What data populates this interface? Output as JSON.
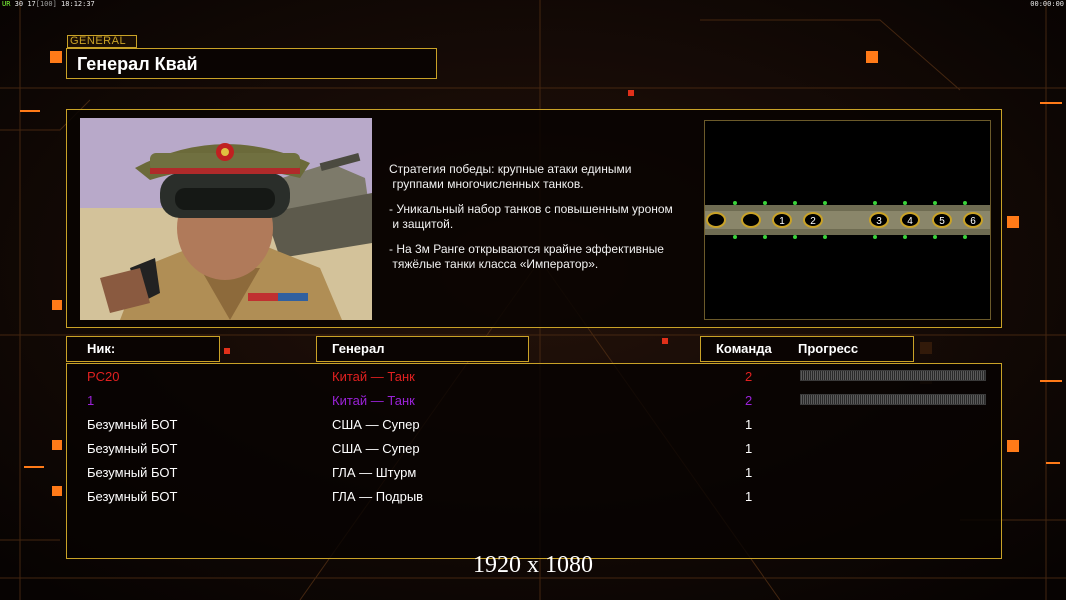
{
  "hud": {
    "left_tag": "UR",
    "left_fps": "30",
    "left_count": "17",
    "left_bracket": "[100]",
    "left_time": "18:12:37",
    "right_time": "00:00:00"
  },
  "header": {
    "tag": "GENERAL",
    "title": "Генерал Квай"
  },
  "info": {
    "desc_1a": "Стратегия победы: крупные атаки едиными",
    "desc_1b": "группами многочисленных танков.",
    "desc_2a": "- Уникальный набор танков с повышенным уроном",
    "desc_2b": "и защитой.",
    "desc_3a": "- На 3м Ранге открываются крайне эффективные",
    "desc_3b": "тяжёлые танки класса «Император».",
    "map_slots": [
      "1",
      "2",
      "3",
      "4",
      "5",
      "6"
    ]
  },
  "table": {
    "col_nick": "Ник:",
    "col_general": "Генерал",
    "col_team": "Команда",
    "col_progress": "Прогресс",
    "rows": [
      {
        "nick": "PC20",
        "general": "Китай — Танк",
        "team": "2",
        "color": "#e02020",
        "progress": true
      },
      {
        "nick": "1",
        "general": "Китай — Танк",
        "team": "2",
        "color": "#9a22d8",
        "progress": true
      },
      {
        "nick": "Безумный БОТ",
        "general": "США — Супер",
        "team": "1",
        "color": "#ffffff",
        "progress": false
      },
      {
        "nick": "Безумный БОТ",
        "general": "США — Супер",
        "team": "1",
        "color": "#ffffff",
        "progress": false
      },
      {
        "nick": "Безумный БОТ",
        "general": "ГЛА — Штурм",
        "team": "1",
        "color": "#ffffff",
        "progress": false
      },
      {
        "nick": "Безумный БОТ",
        "general": "ГЛА — Подрыв",
        "team": "1",
        "color": "#ffffff",
        "progress": false
      }
    ]
  },
  "resolution_label": "1920 x 1080",
  "colors": {
    "accent": "#c9a227",
    "bg": "#0d0603",
    "orange": "#ff7a18"
  }
}
